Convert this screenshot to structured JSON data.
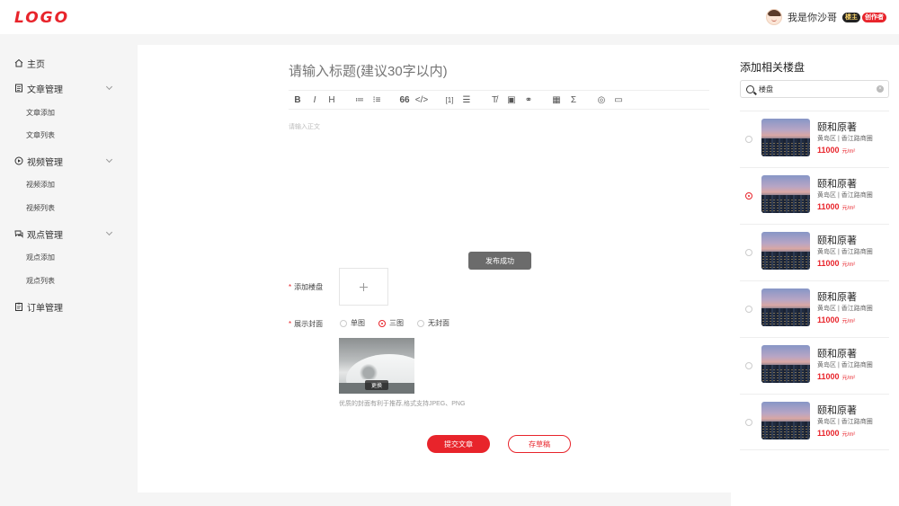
{
  "header": {
    "logo": "LOGO",
    "username": "我是你沙哥",
    "badges": [
      "楼主",
      "创作者"
    ]
  },
  "sidebar": {
    "items": [
      {
        "label": "主页",
        "icon": "home-icon"
      },
      {
        "label": "文章管理",
        "icon": "document-icon",
        "children": [
          "文章添加",
          "文章列表"
        ]
      },
      {
        "label": "视频管理",
        "icon": "play-icon",
        "children": [
          "视频添加",
          "视频列表"
        ]
      },
      {
        "label": "观点管理",
        "icon": "chat-icon",
        "children": [
          "观点添加",
          "观点列表"
        ]
      },
      {
        "label": "订单管理",
        "icon": "clipboard-icon"
      }
    ]
  },
  "editor": {
    "title_placeholder": "请输入标题(建议30字以内)",
    "body_placeholder": "请输入正文",
    "toast": "发布成功",
    "add_property_label": "添加楼盘",
    "cover_label": "展示封面",
    "cover_options": [
      "单图",
      "三图",
      "无封面"
    ],
    "cover_selected": "三图",
    "replace_label": "更换",
    "hint": "优质的封面有利于推荐,格式支持JPEG、PNG",
    "submit_label": "提交文章",
    "draft_label": "存草稿",
    "toolbar_glyphs": [
      "B",
      "I",
      "H",
      "≔",
      "⁝≡",
      "66",
      "</>",
      "[1]",
      "☰",
      "T̸",
      "▣",
      "⚭",
      "▦",
      "Σ",
      "◎",
      "▭"
    ]
  },
  "panel": {
    "title": "添加相关楼盘",
    "search_value": "楼盘",
    "properties": [
      {
        "name": "颐和原著",
        "location": "黄岛区 | 香江路商圈",
        "price": "11000",
        "unit": "元/m²",
        "selected": false
      },
      {
        "name": "颐和原著",
        "location": "黄岛区 | 香江路商圈",
        "price": "11000",
        "unit": "元/m²",
        "selected": true
      },
      {
        "name": "颐和原著",
        "location": "黄岛区 | 香江路商圈",
        "price": "11000",
        "unit": "元/m²",
        "selected": false
      },
      {
        "name": "颐和原著",
        "location": "黄岛区 | 香江路商圈",
        "price": "11000",
        "unit": "元/m²",
        "selected": false
      },
      {
        "name": "颐和原著",
        "location": "黄岛区 | 香江路商圈",
        "price": "11000",
        "unit": "元/m²",
        "selected": false
      },
      {
        "name": "颐和原著",
        "location": "黄岛区 | 香江路商圈",
        "price": "11000",
        "unit": "元/m²",
        "selected": false
      }
    ]
  },
  "colors": {
    "accent": "#e8242b",
    "background": "#f5f5f5"
  }
}
